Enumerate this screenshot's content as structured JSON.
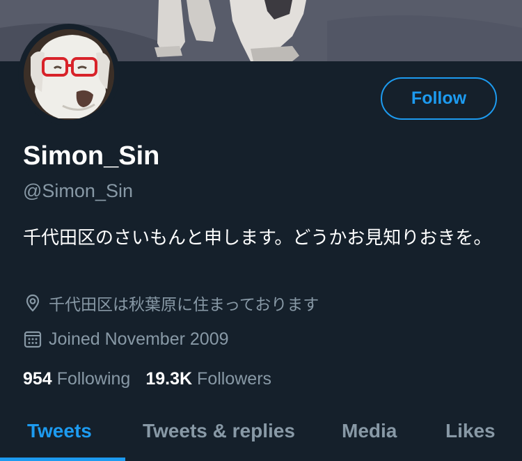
{
  "profile": {
    "display_name": "Simon_Sin",
    "handle": "@Simon_Sin",
    "bio": "千代田区のさいもんと申します。どうかお見知りおきを。",
    "location": "千代田区は秋葉原に住まっております",
    "joined": "Joined November 2009",
    "following_count": "954",
    "following_label": "Following",
    "followers_count": "19.3K",
    "followers_label": "Followers"
  },
  "actions": {
    "follow_label": "Follow"
  },
  "tabs": [
    {
      "label": "Tweets",
      "active": true
    },
    {
      "label": "Tweets & replies",
      "active": false
    },
    {
      "label": "Media",
      "active": false
    },
    {
      "label": "Likes",
      "active": false
    }
  ],
  "colors": {
    "background": "#15202b",
    "accent": "#1d9bf0",
    "secondary_text": "#8899a6"
  }
}
